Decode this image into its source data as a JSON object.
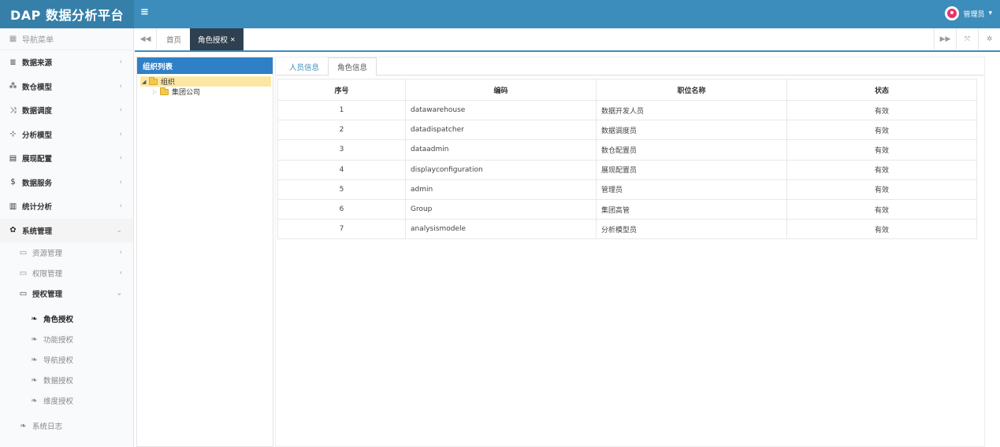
{
  "app": {
    "title": "DAP 数据分析平台",
    "menu_toggle": "≡"
  },
  "user": {
    "name": "管理员",
    "caret": "▾"
  },
  "sidebar": {
    "header": "导航菜单",
    "items": [
      {
        "label": "数据来源",
        "icon": "database-icon",
        "glyph": "≣"
      },
      {
        "label": "数仓模型",
        "icon": "cubes-icon",
        "glyph": "⁂"
      },
      {
        "label": "数据调度",
        "icon": "random-icon",
        "glyph": "⤨"
      },
      {
        "label": "分析模型",
        "icon": "sitemap-icon",
        "glyph": "⊹"
      },
      {
        "label": "展现配置",
        "icon": "film-icon",
        "glyph": "▤"
      },
      {
        "label": "数据服务",
        "icon": "dollar-icon",
        "glyph": "$"
      },
      {
        "label": "统计分析",
        "icon": "bar-chart-icon",
        "glyph": "▥"
      },
      {
        "label": "系统管理",
        "icon": "gear-icon",
        "glyph": "✿"
      }
    ],
    "sub_items": [
      {
        "label": "资源管理"
      },
      {
        "label": "权限管理"
      },
      {
        "label": "授权管理"
      }
    ],
    "leaf_items": [
      {
        "label": "角色授权"
      },
      {
        "label": "功能授权"
      },
      {
        "label": "导航授权"
      },
      {
        "label": "数据授权"
      },
      {
        "label": "维度授权"
      }
    ],
    "log_item": "系统日志",
    "chev_collapsed": "‹",
    "chev_open": "⌄"
  },
  "tabs": {
    "home": "首页",
    "active": "角色授权",
    "close": "✕"
  },
  "org": {
    "title": "组织列表",
    "root": "组织",
    "child": "集团公司"
  },
  "content": {
    "tab_people": "人员信息",
    "tab_roles": "角色信息",
    "columns": [
      "序号",
      "编码",
      "职位名称",
      "状态"
    ],
    "rows": [
      [
        "1",
        "datawarehouse",
        "数据开发人员",
        "有效"
      ],
      [
        "2",
        "datadispatcher",
        "数据调度员",
        "有效"
      ],
      [
        "3",
        "dataadmin",
        "数仓配置员",
        "有效"
      ],
      [
        "4",
        "displayconfiguration",
        "展现配置员",
        "有效"
      ],
      [
        "5",
        "admin",
        "管理员",
        "有效"
      ],
      [
        "6",
        "Group",
        "集团高管",
        "有效"
      ],
      [
        "7",
        "analysismodele",
        "分析模型员",
        "有效"
      ]
    ]
  }
}
